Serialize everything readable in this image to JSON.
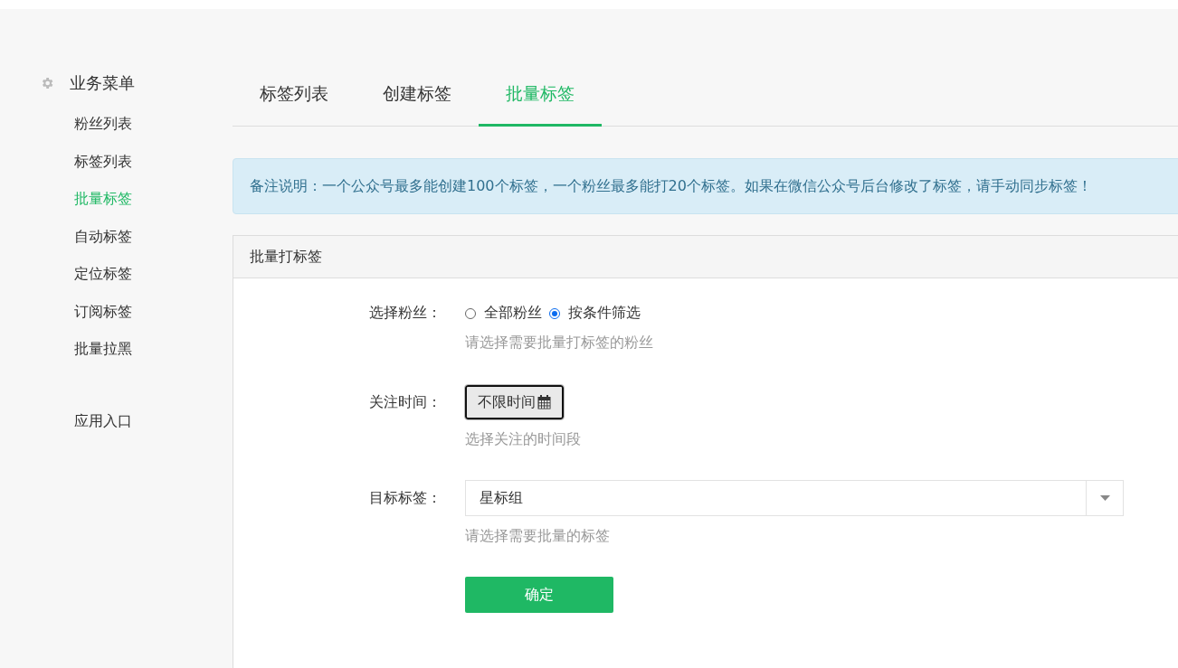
{
  "sidebar": {
    "title": "业务菜单",
    "items": [
      {
        "label": "粉丝列表",
        "selected": false
      },
      {
        "label": "标签列表",
        "selected": false
      },
      {
        "label": "批量标签",
        "selected": true
      },
      {
        "label": "自动标签",
        "selected": false
      },
      {
        "label": "定位标签",
        "selected": false
      },
      {
        "label": "订阅标签",
        "selected": false
      },
      {
        "label": "批量拉黑",
        "selected": false
      }
    ],
    "footer_item": {
      "label": "应用入口",
      "selected": false
    }
  },
  "tabs": [
    {
      "label": "标签列表",
      "selected": false
    },
    {
      "label": "创建标签",
      "selected": false
    },
    {
      "label": "批量标签",
      "selected": true
    }
  ],
  "notice": "备注说明：一个公众号最多能创建100个标签，一个粉丝最多能打20个标签。如果在微信公众号后台修改了标签，请手动同步标签！",
  "panel": {
    "title": "批量打标签",
    "fans": {
      "label": "选择粉丝：",
      "options": [
        {
          "label": "全部粉丝",
          "selected": false
        },
        {
          "label": "按条件筛选",
          "selected": true
        }
      ],
      "hint": "请选择需要批量打标签的粉丝"
    },
    "follow_time": {
      "label": "关注时间：",
      "value": "不限时间",
      "hint": "选择关注的时间段"
    },
    "target_tag": {
      "label": "目标标签：",
      "value": "星标组",
      "hint": "请选择需要批量的标签"
    },
    "submit": "确定"
  }
}
